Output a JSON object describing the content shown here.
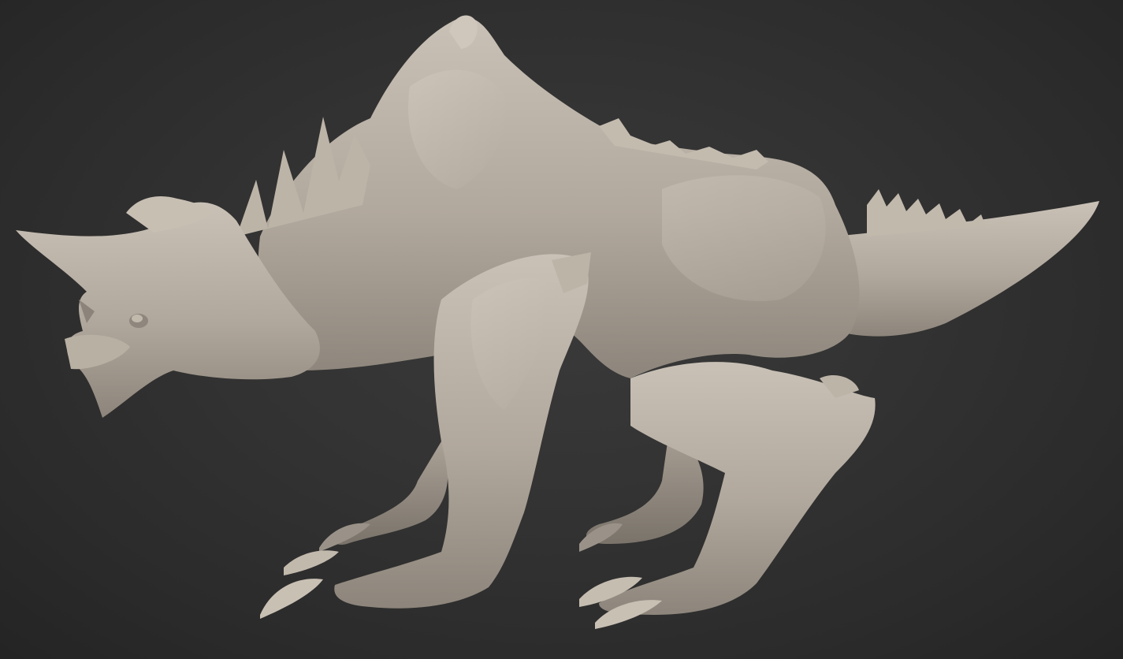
{
  "viewport": {
    "background_color": "#2f2f2f",
    "model_color": "#b3aa9f",
    "subject": "creature-sculpt"
  }
}
